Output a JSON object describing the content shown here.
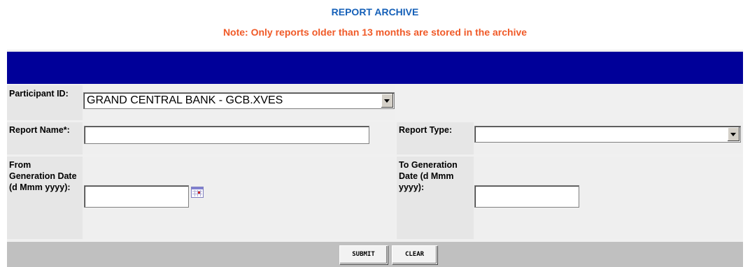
{
  "header": {
    "title": "REPORT ARCHIVE",
    "note": "Note: Only reports older than 13 months are stored in the archive"
  },
  "form": {
    "participant_id": {
      "label": "Participant ID:",
      "value": "GRAND CENTRAL BANK - GCB.XVES"
    },
    "report_name": {
      "label": "Report Name*:",
      "value": ""
    },
    "report_type": {
      "label": "Report Type:",
      "value": ""
    },
    "from_date": {
      "label": "From Generation Date (d Mmm yyyy):",
      "value": ""
    },
    "to_date": {
      "label": "To Generation Date (d Mmm yyyy):",
      "value": ""
    }
  },
  "buttons": {
    "submit": "SUBMIT",
    "clear": "CLEAR"
  },
  "colors": {
    "title": "#1560b8",
    "note": "#f05a28",
    "header_bar": "#000099"
  }
}
